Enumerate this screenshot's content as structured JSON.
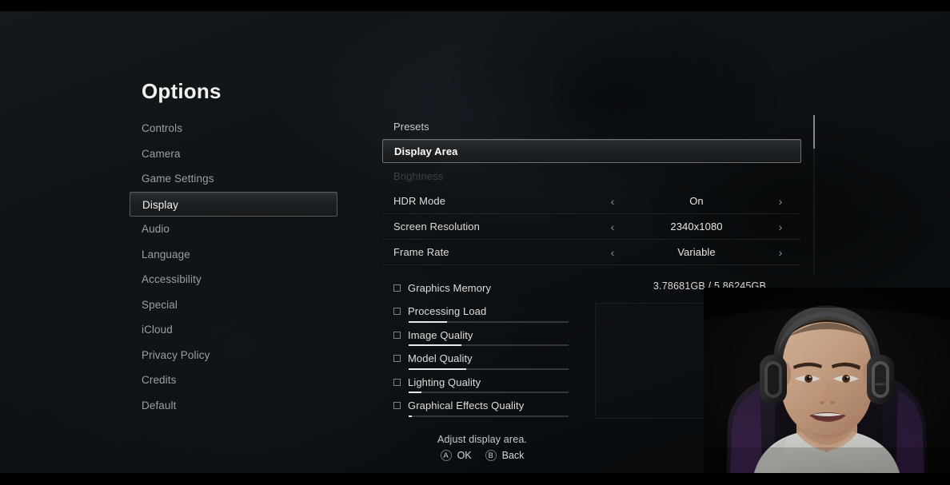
{
  "page_title": "Options",
  "sidebar": {
    "items": [
      {
        "label": "Controls",
        "selected": false
      },
      {
        "label": "Camera",
        "selected": false
      },
      {
        "label": "Game Settings",
        "selected": false
      },
      {
        "label": "Display",
        "selected": true
      },
      {
        "label": "Audio",
        "selected": false
      },
      {
        "label": "Language",
        "selected": false
      },
      {
        "label": "Accessibility",
        "selected": false
      },
      {
        "label": "Special",
        "selected": false
      },
      {
        "label": "iCloud",
        "selected": false
      },
      {
        "label": "Privacy Policy",
        "selected": false
      },
      {
        "label": "Credits",
        "selected": false
      },
      {
        "label": "Default",
        "selected": false
      }
    ]
  },
  "settings": {
    "rows": [
      {
        "label": "Presets",
        "value": null,
        "state": "plain"
      },
      {
        "label": "Display Area",
        "value": null,
        "state": "selected"
      },
      {
        "label": "Brightness",
        "value": null,
        "state": "disabled"
      },
      {
        "label": "HDR Mode",
        "value": "On",
        "state": "value"
      },
      {
        "label": "Screen Resolution",
        "value": "2340x1080",
        "state": "value"
      },
      {
        "label": "Frame Rate",
        "value": "Variable",
        "state": "value"
      }
    ],
    "prev_chevron": "‹",
    "next_chevron": "›"
  },
  "metrics": {
    "rows": [
      {
        "label": "Graphics Memory",
        "value": "3.78681GB  /  5.86245GB",
        "bar": null
      },
      {
        "label": "Processing Load",
        "value": null,
        "bar": 24
      },
      {
        "label": "Image Quality",
        "value": null,
        "bar": 33
      },
      {
        "label": "Model Quality",
        "value": null,
        "bar": 36
      },
      {
        "label": "Lighting Quality",
        "value": null,
        "bar": 8
      },
      {
        "label": "Graphical Effects Quality",
        "value": null,
        "bar": 2
      }
    ]
  },
  "footer": {
    "hint": "Adjust display area.",
    "buttons": [
      {
        "glyph": "A",
        "label": "OK"
      },
      {
        "glyph": "B",
        "label": "Back"
      }
    ]
  },
  "colors": {
    "accent": "#e8e8e8",
    "text_primary": "#f0f0f0",
    "text_muted": "#9a9fa3",
    "text_disabled": "#3b4043",
    "background": "#0e1215",
    "selected_border": "#6b6f72"
  }
}
